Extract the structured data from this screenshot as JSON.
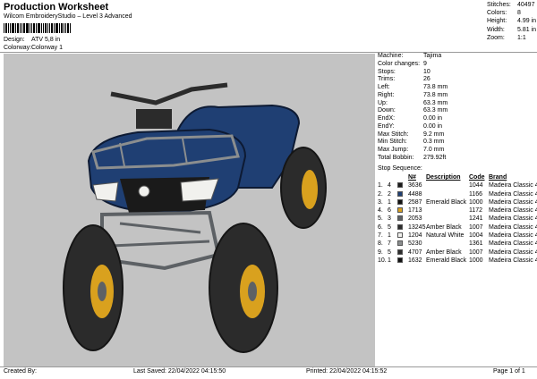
{
  "header": {
    "title": "Production Worksheet",
    "subtitle": "Wilcom EmbroideryStudio – Level 3 Advanced"
  },
  "design": {
    "label": "Design:",
    "value": "ATV 5,8 in"
  },
  "colorway": {
    "label": "Colorway:",
    "value": "Colorway 1"
  },
  "stats": [
    {
      "label": "Stitches:",
      "value": "40497"
    },
    {
      "label": "Colors:",
      "value": "8"
    },
    {
      "label": "Height:",
      "value": "4.99 in"
    },
    {
      "label": "Width:",
      "value": "5.81 in"
    },
    {
      "label": "Zoom:",
      "value": "1:1"
    }
  ],
  "machine": [
    {
      "label": "Machine:",
      "value": "Tajima"
    },
    {
      "label": "Color changes:",
      "value": "9"
    },
    {
      "label": "Stops:",
      "value": "10"
    },
    {
      "label": "Trims:",
      "value": "26"
    },
    {
      "label": "Left:",
      "value": "73.8 mm"
    },
    {
      "label": "Right:",
      "value": "73.8 mm"
    },
    {
      "label": "Up:",
      "value": "63.3 mm"
    },
    {
      "label": "Down:",
      "value": "63.3 mm"
    },
    {
      "label": "EndX:",
      "value": "0.00 in"
    },
    {
      "label": "EndY:",
      "value": "0.00 in"
    },
    {
      "label": "Max Stitch:",
      "value": "9.2 mm"
    },
    {
      "label": "Min Stitch:",
      "value": "0.3 mm"
    },
    {
      "label": "Max Jump:",
      "value": "7.0 mm"
    },
    {
      "label": "Total Bobbin:",
      "value": "279.92ft"
    }
  ],
  "sequence": {
    "title": "Stop Sequence:",
    "headers": {
      "n": "N#",
      "desc": "Description",
      "code": "Code",
      "brand": "Brand"
    },
    "rows": [
      {
        "stop": "1.",
        "n": "4",
        "num": "3636",
        "desc": "",
        "code": "1044",
        "brand": "Madeira Classic 40",
        "color": "#1a1a1a"
      },
      {
        "stop": "2.",
        "n": "2",
        "num": "4488",
        "desc": "",
        "code": "1166",
        "brand": "Madeira Classic 40",
        "color": "#1f3f73"
      },
      {
        "stop": "3.",
        "n": "1",
        "num": "2587",
        "desc": "Emerald Black",
        "code": "1000",
        "brand": "Madeira Classic 40",
        "color": "#111111"
      },
      {
        "stop": "4.",
        "n": "6",
        "num": "1713",
        "desc": "",
        "code": "1172",
        "brand": "Madeira Classic 40",
        "color": "#d9a11e"
      },
      {
        "stop": "5.",
        "n": "3",
        "num": "2053",
        "desc": "",
        "code": "1241",
        "brand": "Madeira Classic 40",
        "color": "#5d6165"
      },
      {
        "stop": "6.",
        "n": "5",
        "num": "13245",
        "desc": "Amber Black",
        "code": "1007",
        "brand": "Madeira Classic 40",
        "color": "#2b2b2b"
      },
      {
        "stop": "7.",
        "n": "1",
        "num": "1204",
        "desc": "Natural White",
        "code": "1004",
        "brand": "Madeira Classic 40",
        "color": "#f1f1ee"
      },
      {
        "stop": "8.",
        "n": "7",
        "num": "5230",
        "desc": "",
        "code": "1361",
        "brand": "Madeira Classic 40",
        "color": "#8b8e8f"
      },
      {
        "stop": "9.",
        "n": "5",
        "num": "4707",
        "desc": "Amber Black",
        "code": "1007",
        "brand": "Madeira Classic 40",
        "color": "#2b2b2b"
      },
      {
        "stop": "10.",
        "n": "1",
        "num": "1632",
        "desc": "Emerald Black",
        "code": "1000",
        "brand": "Madeira Classic 40",
        "color": "#111111"
      }
    ]
  },
  "footer": {
    "created": "Created By:",
    "saved": "Last Saved: 22/04/2022 04:15:50",
    "printed": "Printed: 22/04/2022 04:15:52",
    "page": "Page 1 of 1"
  },
  "colors": {
    "preview_bg": "#c3c3c3",
    "body_blue": "#1f3f73",
    "rim": "#d9a11e"
  }
}
